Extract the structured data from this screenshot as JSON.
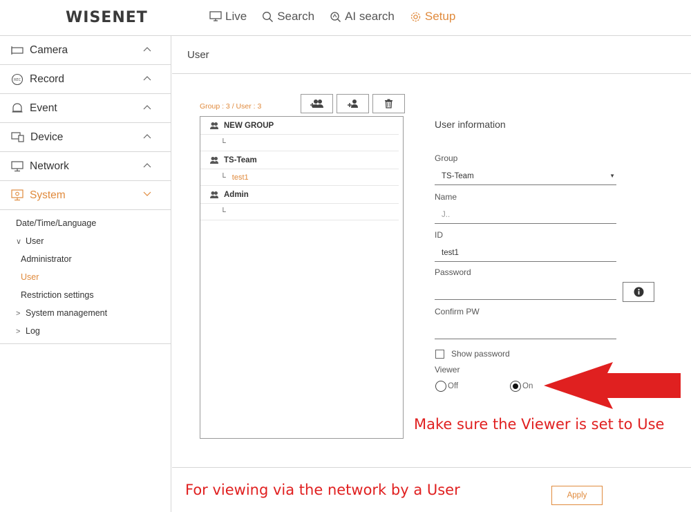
{
  "header": {
    "logo": "WISENET",
    "nav": [
      {
        "label": "Live",
        "icon": "monitor-icon"
      },
      {
        "label": "Search",
        "icon": "search-icon"
      },
      {
        "label": "AI search",
        "icon": "ai-search-icon"
      },
      {
        "label": "Setup",
        "icon": "gear-icon",
        "active": true
      }
    ]
  },
  "sidebar": {
    "groups": [
      {
        "label": "Camera",
        "icon": "camera-icon"
      },
      {
        "label": "Record",
        "icon": "rec-icon",
        "icon_text": "REC"
      },
      {
        "label": "Event",
        "icon": "bell-icon"
      },
      {
        "label": "Device",
        "icon": "device-icon"
      },
      {
        "label": "Network",
        "icon": "network-icon"
      },
      {
        "label": "System",
        "icon": "system-icon",
        "active": true
      }
    ],
    "system_items": [
      {
        "label": "Date/Time/Language",
        "level": 1
      },
      {
        "label": "User",
        "level": 1,
        "toggle": "∨"
      },
      {
        "label": "Administrator",
        "level": 2
      },
      {
        "label": "User",
        "level": 2,
        "active": true
      },
      {
        "label": "Restriction settings",
        "level": 2
      },
      {
        "label": "System management",
        "level": 1,
        "toggle": ">"
      },
      {
        "label": "Log",
        "level": 1,
        "toggle": ">"
      }
    ]
  },
  "main": {
    "title": "User",
    "group_count": "Group : 3 / User : 3",
    "tree": [
      {
        "group": "NEW GROUP",
        "user": ""
      },
      {
        "group": "TS-Team",
        "user": "test1",
        "selected": true
      },
      {
        "group": "Admin",
        "user": ""
      }
    ],
    "form": {
      "title": "User information",
      "group_label": "Group",
      "group_value": "TS-Team",
      "name_label": "Name",
      "name_value": "J..",
      "id_label": "ID",
      "id_value": "test1",
      "password_label": "Password",
      "password_value": "",
      "confirm_label": "Confirm PW",
      "confirm_value": "",
      "show_password_label": "Show password",
      "viewer_label": "Viewer",
      "viewer_off": "Off",
      "viewer_on": "On",
      "viewer_value": "On"
    },
    "apply_label": "Apply"
  },
  "annotations": {
    "viewer_note": "Make sure the Viewer is set to Use",
    "network_note": "For viewing via the network by a User",
    "color": "#e02020"
  },
  "colors": {
    "accent": "#e08a3c",
    "annotation": "#e02020"
  }
}
